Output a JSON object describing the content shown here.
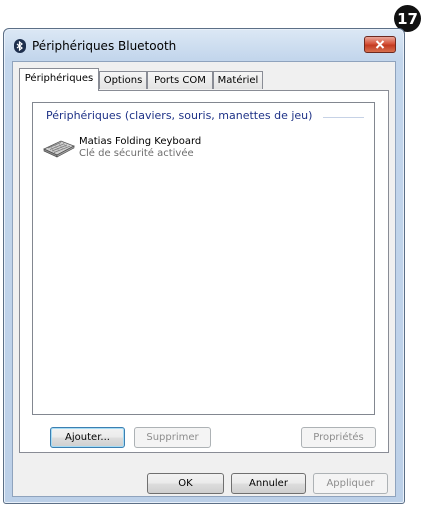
{
  "step_badge": "17",
  "window": {
    "title": "Périphériques Bluetooth",
    "icon": "bluetooth-icon",
    "close_icon": "close-icon"
  },
  "tabs": [
    {
      "label": "Périphériques",
      "active": true
    },
    {
      "label": "Options",
      "active": false
    },
    {
      "label": "Ports COM",
      "active": false
    },
    {
      "label": "Matériel",
      "active": false
    }
  ],
  "devices_panel": {
    "group_header": "Périphériques (claviers, souris, manettes de jeu)",
    "devices": [
      {
        "name": "Matias Folding Keyboard",
        "status": "Clé de sécurité activée",
        "icon": "keyboard-icon"
      }
    ]
  },
  "panel_buttons": {
    "add": "Ajouter...",
    "remove": "Supprimer",
    "properties": "Propriétés"
  },
  "dialog_buttons": {
    "ok": "OK",
    "cancel": "Annuler",
    "apply": "Appliquer"
  }
}
